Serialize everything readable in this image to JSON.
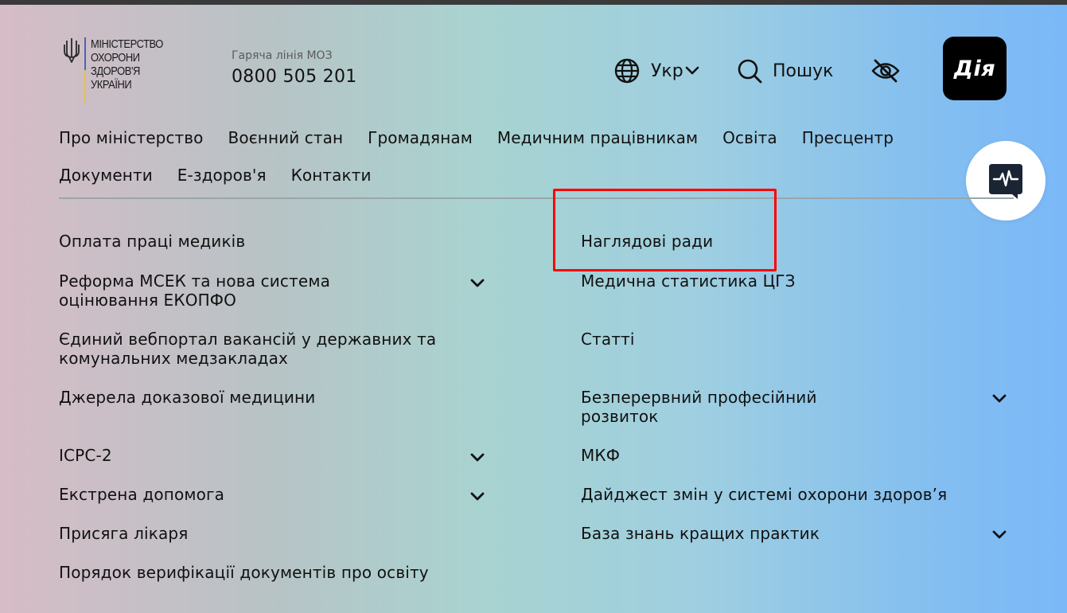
{
  "logo": {
    "lines": [
      "Міністерство",
      "охорони",
      "здоров'я",
      "України"
    ]
  },
  "hotline": {
    "label": "Гаряча лінія МОЗ",
    "phone": "0800 505 201"
  },
  "header": {
    "language_label": "Укр",
    "search_label": "Пошук",
    "diia_label": "Дія"
  },
  "main_nav": [
    [
      "Про міністерство",
      "Воєнний стан",
      "Громадянам",
      "Медичним працівникам",
      "Освіта",
      "Пресцентр"
    ],
    [
      "Документи",
      "Е-здоров'я",
      "Контакти"
    ]
  ],
  "submenu": {
    "left": [
      {
        "label": "Оплата праці медиків",
        "expandable": false
      },
      {
        "label": "Реформа МСЕК та нова система оцінювання ЕКОПФО",
        "line1": "Реформа МСЕК та нова система",
        "line2": "оцінювання ЕКОПФО",
        "expandable": true
      },
      {
        "label": "Єдиний вебпортал вакансій у державних та комунальних медзакладах",
        "line1": "Єдиний вебпортал вакансій у державних та",
        "line2": "комунальних медзакладах",
        "expandable": false
      },
      {
        "label": "Джерела доказової медицини",
        "expandable": false
      },
      {
        "label": "ICPC-2",
        "expandable": true
      },
      {
        "label": "Екстрена допомога",
        "expandable": true
      },
      {
        "label": "Присяга лікаря",
        "expandable": false
      },
      {
        "label": "Порядок верифікації документів про освіту",
        "expandable": false
      }
    ],
    "right": [
      {
        "label": "Наглядові ради",
        "expandable": false
      },
      {
        "label": "Медична статистика ЦГЗ",
        "expandable": false
      },
      {
        "label": "Статті",
        "expandable": false
      },
      {
        "label": "Безперервний професійний розвиток",
        "line1": "Безперервний професійний",
        "line2": "розвиток",
        "expandable": true
      },
      {
        "label": "МКФ",
        "expandable": false
      },
      {
        "label": "Дайджест змін у системі охорони здоров’я",
        "expandable": false
      },
      {
        "label": "База знань кращих практик",
        "expandable": true
      }
    ]
  },
  "icons": {
    "language": "globe-icon",
    "search": "search-icon",
    "accessibility": "eye-off-icon",
    "chat": "chat-pulse-icon",
    "expand": "chevron-down-icon"
  },
  "colors": {
    "highlight": "#ff0000",
    "diia_bg": "#000000",
    "chat_icon": "#1b2433"
  }
}
